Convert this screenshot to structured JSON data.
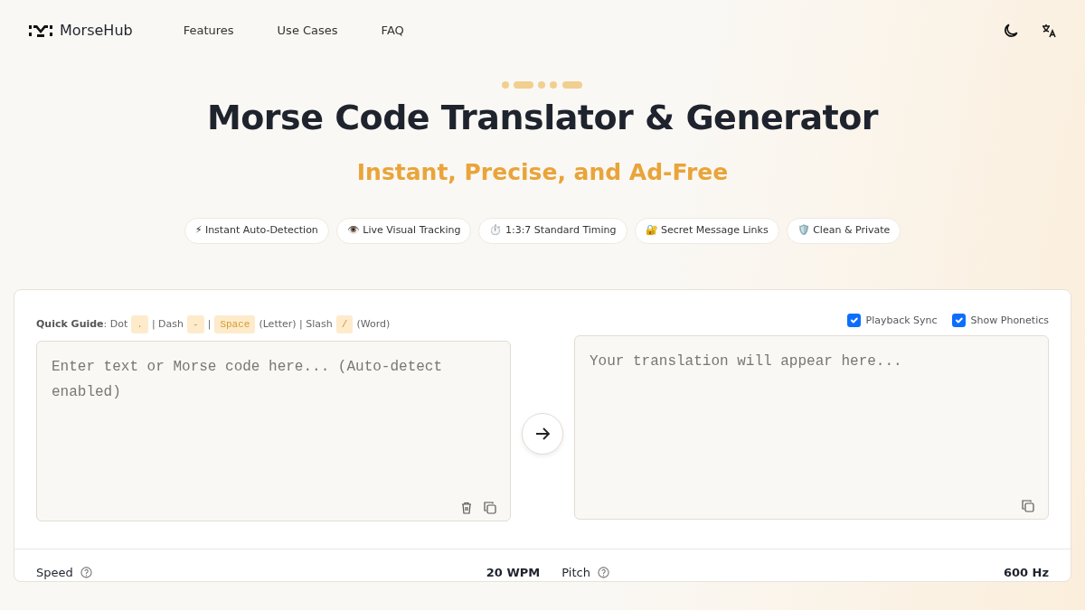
{
  "brand": {
    "name": "MorseHub"
  },
  "nav": [
    {
      "label": "Features"
    },
    {
      "label": "Use Cases"
    },
    {
      "label": "FAQ"
    }
  ],
  "hero": {
    "title": "Morse Code Translator & Generator",
    "subtitle": "Instant, Precise, and Ad-Free"
  },
  "features": [
    {
      "label": "⚡ Instant Auto-Detection"
    },
    {
      "label": "👁️ Live Visual Tracking"
    },
    {
      "label": "⏱️ 1:3:7 Standard Timing"
    },
    {
      "label": "🔐 Secret Message Links"
    },
    {
      "label": "🛡️ Clean & Private"
    }
  ],
  "guide": [
    {
      "kind": "label",
      "text": "Quick Guide"
    },
    {
      "kind": "text",
      "text": ": Dot"
    },
    {
      "kind": "key",
      "text": "."
    },
    {
      "kind": "text",
      "text": "| Dash"
    },
    {
      "kind": "key",
      "text": "-"
    },
    {
      "kind": "text",
      "text": "|"
    },
    {
      "kind": "key",
      "text": "Space"
    },
    {
      "kind": "text",
      "text": "(Letter) | Slash"
    },
    {
      "kind": "key",
      "text": "/"
    },
    {
      "kind": "text",
      "text": "(Word)"
    }
  ],
  "options": [
    {
      "label": "Playback Sync",
      "checked": true
    },
    {
      "label": "Show Phonetics",
      "checked": true
    }
  ],
  "input": {
    "placeholder": "Enter text or Morse code here... (Auto-detect enabled)"
  },
  "output": {
    "placeholder": "Your translation will appear here..."
  },
  "settings": [
    {
      "label": "Speed",
      "value": "20 WPM"
    },
    {
      "label": "Pitch",
      "value": "600 Hz"
    }
  ]
}
